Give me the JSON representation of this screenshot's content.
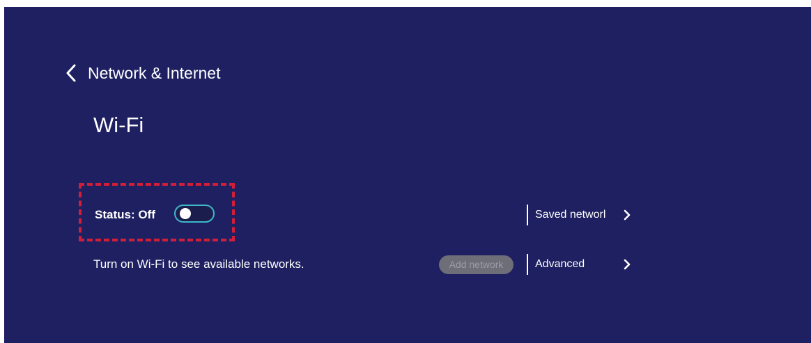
{
  "header": {
    "back_title": "Network & Internet"
  },
  "page": {
    "title": "Wi-Fi"
  },
  "wifi": {
    "status_label": "Status: Off",
    "enabled": false,
    "hint": "Turn on Wi-Fi to see available networks.",
    "add_network_label": "Add network"
  },
  "side_menu": {
    "saved_networks_label": "Saved networl",
    "advanced_label": "Advanced"
  },
  "colors": {
    "background": "#1e2061",
    "highlight_dash": "#d11f3a",
    "toggle_border": "#3fb8c9",
    "disabled_button": "#6e6e78"
  },
  "icons": {
    "back": "chevron-left-icon",
    "item_arrow": "chevron-right-icon"
  }
}
